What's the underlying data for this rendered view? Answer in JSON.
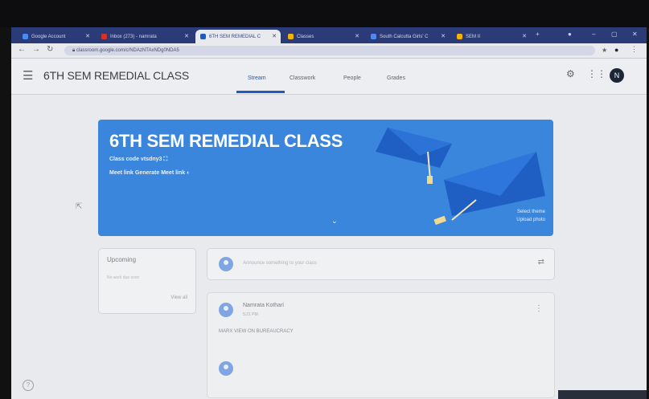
{
  "browser": {
    "tabs": [
      {
        "label": "Google Account",
        "color": "#4a8af4"
      },
      {
        "label": "Inbox (273) - namrata",
        "color": "#d93025"
      },
      {
        "label": "6TH SEM REMEDIAL C",
        "color": "#1e8e3e"
      },
      {
        "label": "Classes",
        "color": "#f4b400"
      },
      {
        "label": "South Calcutta Girls' C",
        "color": "#4a8af4"
      },
      {
        "label": "SEM II",
        "color": "#f4b400"
      }
    ],
    "url": "classroom.google.com/c/NDAzNTAxNDg0NDA5"
  },
  "header": {
    "class_name": "6TH SEM REMEDIAL CLASS",
    "nav": [
      "Stream",
      "Classwork",
      "People",
      "Grades"
    ],
    "active_nav": "Stream",
    "avatar_initial": "N"
  },
  "banner": {
    "title": "6TH SEM REMEDIAL CLASS",
    "class_code_label": "Class code",
    "class_code": "vtsdny3",
    "meet_label": "Meet link",
    "meet_action": "Generate Meet link",
    "select_theme": "Select theme",
    "upload_photo": "Upload photo",
    "color": "#3a86dd"
  },
  "upcoming": {
    "title": "Upcoming",
    "subtitle": "No work due soon",
    "view_all": "View all"
  },
  "announce": {
    "placeholder": "Announce something to your class"
  },
  "post": {
    "author": "Namrata Kothari",
    "time": "5:21 PM",
    "body": "MARX VIEW ON BUREAUCRACY"
  }
}
